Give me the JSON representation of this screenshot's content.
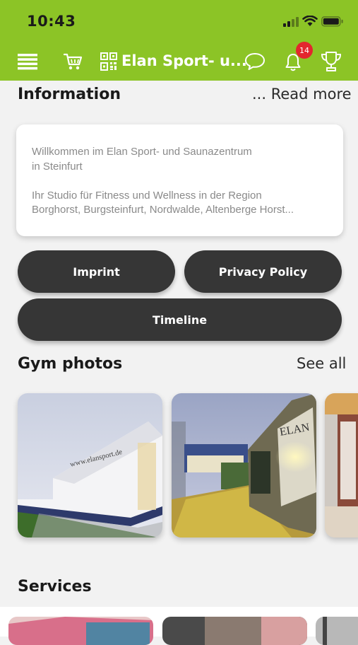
{
  "status_bar": {
    "time": "10:43"
  },
  "app_bar": {
    "title": "Elan Sport- u...",
    "notification_count": "14",
    "icons": [
      "menu-icon",
      "cart-icon",
      "qr-code-icon",
      "chat-bubble-icon",
      "bell-icon",
      "trophy-icon"
    ]
  },
  "information": {
    "title": "Information",
    "read_more": "... Read more",
    "text_line1": "Willkommen im Elan Sport- und Saunazentrum",
    "text_line2": "in Steinfurt",
    "text_line3": "Ihr Studio für Fitness und Wellness in der Region",
    "text_line4": "Borghorst, Burgsteinfurt, Nordwalde, Altenberge Horst..."
  },
  "buttons": {
    "imprint": "Imprint",
    "privacy": "Privacy Policy",
    "timeline": "Timeline"
  },
  "gym_photos": {
    "title": "Gym photos",
    "see_all": "See all",
    "photo1_sign": "www.elansport.de",
    "photo2_sign": "ELAN"
  },
  "services": {
    "title": "Services"
  },
  "colors": {
    "accent": "#8cc426",
    "button": "#363636",
    "badge": "#e3262e"
  }
}
